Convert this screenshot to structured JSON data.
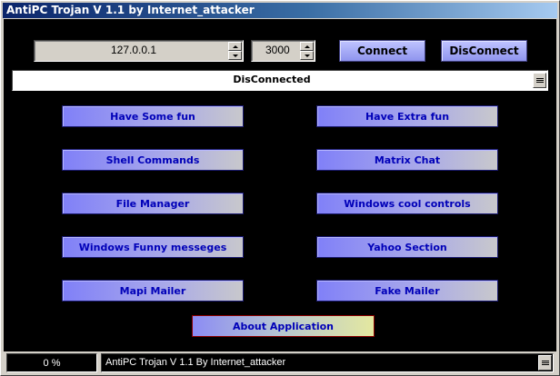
{
  "window": {
    "title": "AntiPC Trojan V 1.1 by Internet_attacker"
  },
  "connection": {
    "ip_value": "127.0.0.1",
    "port_value": "3000",
    "connect_label": "Connect",
    "disconnect_label": "DisConnect",
    "status_text": "DisConnected"
  },
  "features": {
    "left": [
      "Have Some fun",
      "Shell Commands",
      "File Manager",
      "Windows Funny messeges",
      "Mapi Mailer"
    ],
    "right": [
      "Have Extra fun",
      "Matrix Chat",
      "Windows cool controls",
      "Yahoo Section",
      "Fake Mailer"
    ]
  },
  "about_label": "About Application",
  "statusbar": {
    "progress_text": "0 %",
    "progress_value": 0,
    "message": "AntiPC Trojan V 1.1 By Internet_attacker"
  },
  "colors": {
    "button_text": "#0000b8",
    "background": "#000000",
    "title_start": "#0a246a",
    "about_border": "#8a0000"
  },
  "icons": [
    "spin-up-icon",
    "spin-down-icon",
    "dropdown-lines-icon"
  ]
}
